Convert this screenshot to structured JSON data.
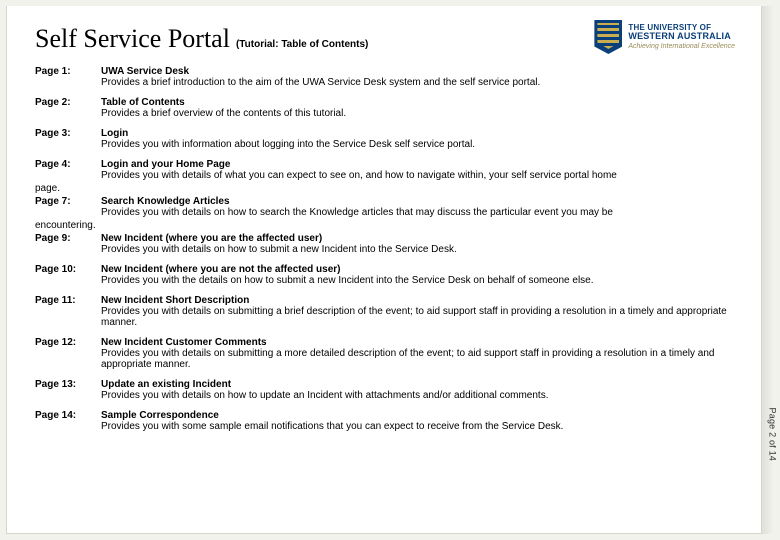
{
  "header": {
    "title": "Self Service Portal",
    "subtitle": "(Tutorial: Table of Contents)"
  },
  "university": {
    "line1": "THE UNIVERSITY OF",
    "line2": "WESTERN AUSTRALIA",
    "tagline": "Achieving International Excellence"
  },
  "side_label": "Page 2 of 14",
  "toc": [
    {
      "page": "Page 1:",
      "title": "UWA Service Desk",
      "desc": "Provides a brief introduction to the aim of the UWA Service Desk system and the self service portal.",
      "cont": ""
    },
    {
      "page": "Page 2:",
      "title": "Table of Contents",
      "desc": "Provides a brief overview of the contents of this tutorial.",
      "cont": ""
    },
    {
      "page": "Page 3:",
      "title": "Login",
      "desc": "Provides you with information about logging into the Service Desk self service portal.",
      "cont": ""
    },
    {
      "page": "Page 4:",
      "title": "Login and your Home Page",
      "desc": "Provides you with details of what you can expect to see on, and how to navigate within, your self service portal home",
      "cont": "page."
    },
    {
      "page": "Page 7:",
      "title": "Search Knowledge Articles",
      "desc": "Provides you with details on how to search the Knowledge articles that may discuss the particular event you may be",
      "cont": "encountering."
    },
    {
      "page": "Page 9:",
      "title": "New Incident (where you are the affected user)",
      "desc": "Provides you with details on how to submit a new Incident into the Service Desk.",
      "cont": ""
    },
    {
      "page": "Page 10:",
      "title": "New Incident (where you are not the affected user)",
      "desc": "Provides you with the details on how to submit a new Incident into the Service Desk on behalf of someone else.",
      "cont": ""
    },
    {
      "page": "Page 11:",
      "title": "New Incident Short Description",
      "desc": "Provides you with details on submitting a brief description of the event; to aid support staff in providing a resolution in a timely and appropriate manner.",
      "cont": ""
    },
    {
      "page": "Page 12:",
      "title": "New Incident Customer Comments",
      "desc": "Provides you with details on submitting a more detailed description of the event; to aid support staff in providing a resolution in a timely and appropriate manner.",
      "cont": ""
    },
    {
      "page": "Page 13:",
      "title": "Update an existing Incident",
      "desc": "Provides you with details on how to update an Incident with attachments and/or additional comments.",
      "cont": ""
    },
    {
      "page": "Page 14:",
      "title": "Sample Correspondence",
      "desc": "Provides you with some sample email notifications that you can expect to receive from the Service Desk.",
      "cont": ""
    }
  ]
}
